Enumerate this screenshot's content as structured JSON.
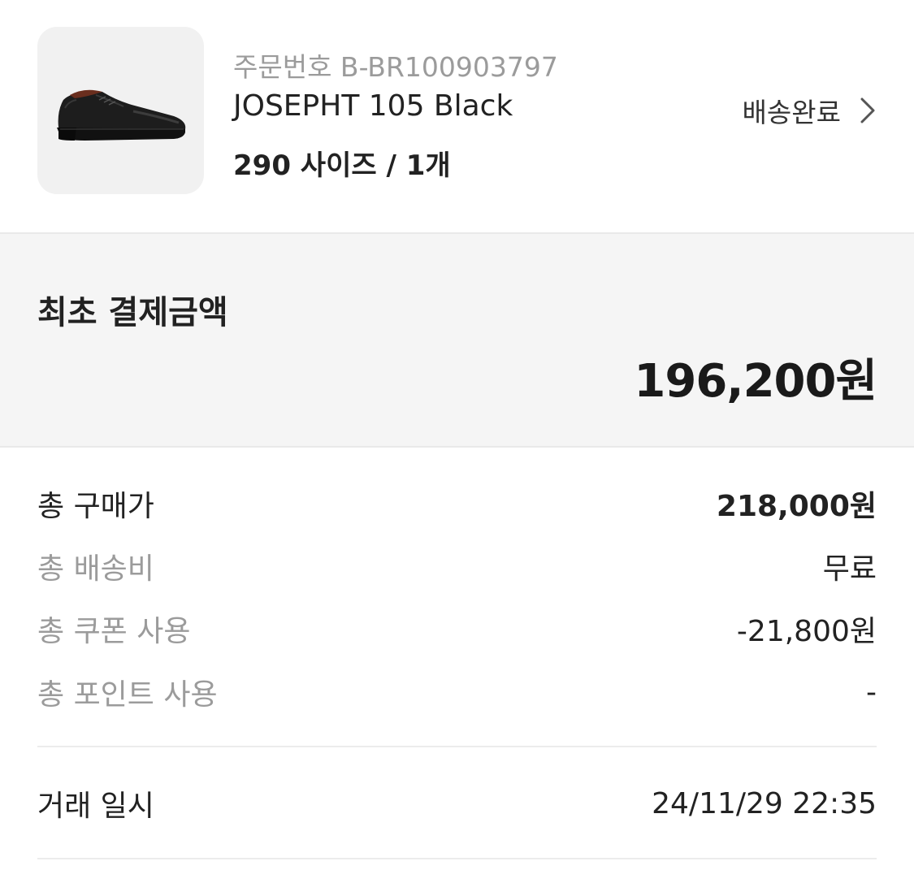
{
  "order": {
    "order_number": "주문번호 B-BR100903797",
    "product_name": "JOSEPHT 105 Black",
    "option": "290 사이즈 / 1개",
    "status": "배송완료",
    "product_image_icon": "shoe-photo",
    "status_icon": "chevron-right-icon"
  },
  "payment": {
    "title": "최초 결제금액",
    "amount": "196,200원"
  },
  "breakdown": [
    {
      "label": "총 구매가",
      "value": "218,000원"
    },
    {
      "label": "총 배송비",
      "value": "무료"
    },
    {
      "label": "총 쿠폰 사용",
      "value": "-21,800원"
    },
    {
      "label": "총 포인트 사용",
      "value": "-"
    }
  ],
  "transaction": {
    "label": "거래 일시",
    "value": "24/11/29 22:35"
  },
  "colors": {
    "text_primary": "#222222",
    "text_muted": "#9b9b9b",
    "panel_background": "#f5f5f5",
    "divider": "#ececec"
  }
}
